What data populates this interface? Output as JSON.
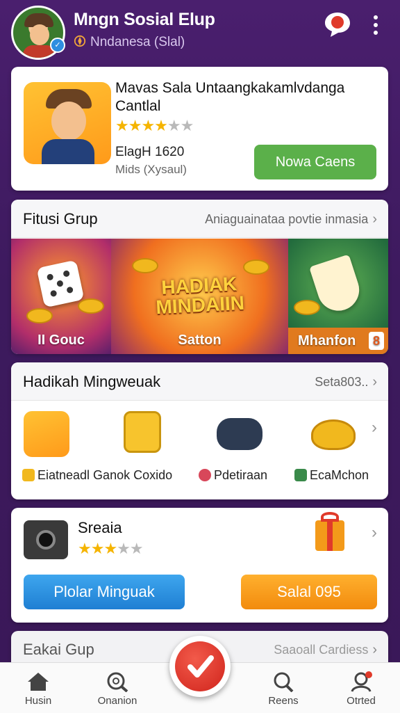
{
  "header": {
    "title": "Mngn Sosial Elup",
    "subtitle": "Nndanesa (Slal)",
    "avatar_badge": "✓"
  },
  "featured": {
    "title": "Mavas Sala Untaangkakamlvdanga Cantlal",
    "rating": 4,
    "rating_max": 5,
    "count": "ElagH 1620",
    "meta": "Mids (Xysaul)",
    "button": "Nowa Caens",
    "button_color": "#5bb04a"
  },
  "featured_group": {
    "title": "Fitusi Grup",
    "link": "Aniaguainataa povtie inmasia",
    "chevron": "›",
    "tiles": [
      {
        "label": "II Gouc"
      },
      {
        "label": "Satton",
        "banner": "HADIAK MINDAIIN"
      },
      {
        "label": "Mhanfon",
        "badge": "8"
      }
    ]
  },
  "rewards": {
    "title": "Hadikah Mingweuak",
    "link": "Seta803..",
    "chevron": "›",
    "items": [
      {
        "label": "Eiatneadl Ganok Coxido"
      },
      {
        "label": "Pdetiraan"
      },
      {
        "label": "EcaMchon"
      }
    ]
  },
  "shop": {
    "name": "Sreaia",
    "rating": 3,
    "rating_max": 5,
    "chevron": "›",
    "primary_button": "Plolar Minguak",
    "secondary_button": "Salal 095"
  },
  "partial_section": {
    "title": "Eakai Gup",
    "link": "Saaoall Cardiess",
    "chevron": "›"
  },
  "bottom_nav": {
    "items": [
      {
        "label": "Husin"
      },
      {
        "label": "Onanion"
      },
      {
        "label": "Reens"
      },
      {
        "label": "Otrted"
      }
    ]
  },
  "colors": {
    "background": "#4a1f6e",
    "accent_green": "#5bb04a",
    "accent_blue": "#2f8ee0",
    "accent_orange": "#f28b0e",
    "fab_red": "#d0241c",
    "star": "#f5b400"
  }
}
